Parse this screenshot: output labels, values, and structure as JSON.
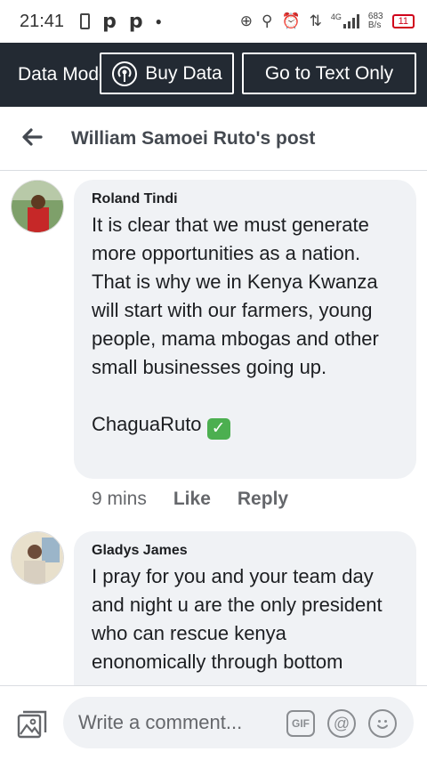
{
  "status_bar": {
    "time": "21:41",
    "network_type": "4G",
    "speed_value": "683",
    "speed_unit": "B/s",
    "battery": "11"
  },
  "data_bar": {
    "mode_label": "Data Mode",
    "buy_data_label": "Buy Data",
    "text_only_label": "Go to Text Only"
  },
  "header": {
    "title": "William Samoei Ruto's post"
  },
  "comments": [
    {
      "author": "Roland Tindi",
      "text": "It is clear that we must generate more opportunities as a nation. That is why we in Kenya Kwanza will start with our farmers, young people, mama mbogas and other small businesses going up.\n\nChaguaRuto",
      "emoji": "✓",
      "time": "9 mins",
      "like_label": "Like",
      "reply_label": "Reply"
    },
    {
      "author": "Gladys James",
      "text": "I pray for you and your team day and night u are the only president who can rescue kenya enonomically through bottom"
    }
  ],
  "composer": {
    "placeholder": "Write a comment...",
    "gif_label": "GIF",
    "mention_symbol": "@"
  },
  "icons": [
    "back-arrow-icon",
    "broadcast-icon",
    "photo-icon",
    "gif-icon",
    "mention-icon",
    "emoji-icon"
  ],
  "colors": {
    "data_bar_bg": "#232a33",
    "bubble_bg": "#f0f2f5",
    "battery_red": "#d0021b"
  }
}
